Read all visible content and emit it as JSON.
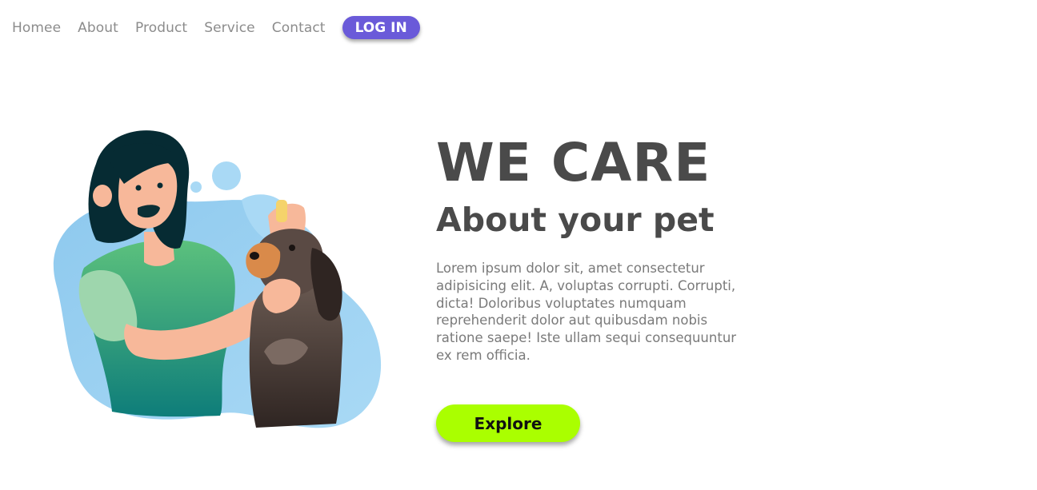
{
  "nav": {
    "items": [
      {
        "label": "Homee"
      },
      {
        "label": "About"
      },
      {
        "label": "Product"
      },
      {
        "label": "Service"
      },
      {
        "label": "Contact"
      }
    ],
    "login_label": "LOG IN"
  },
  "hero": {
    "title": "WE CARE",
    "subtitle": "About your pet",
    "body": "Lorem ipsum dolor sit, amet consectetur adipisicing elit. A, voluptas corrupti. Corrupti, dicta! Doloribus voluptates numquam reprehenderit dolor aut quibusdam nobis ratione saepe! Iste ullam sequi consequuntur ex rem officia.",
    "cta_label": "Explore"
  },
  "colors": {
    "accent": "#6a5ad9",
    "cta": "#aaff00",
    "text": "#4a4a4a",
    "muted": "#8c8c8c"
  },
  "icons": {
    "illustration": "vet-with-dog-illustration"
  }
}
